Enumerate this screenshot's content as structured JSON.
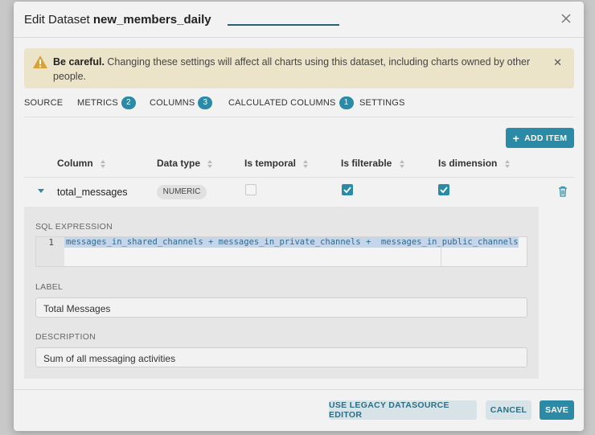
{
  "modal": {
    "title_prefix": "Edit Dataset",
    "dataset_name": "new_members_daily"
  },
  "alert": {
    "strong": "Be careful.",
    "message": "Changing these settings will affect all charts using this dataset, including charts owned by other people."
  },
  "tabs": [
    {
      "label": "SOURCE"
    },
    {
      "label": "METRICS",
      "count": "2"
    },
    {
      "label": "COLUMNS",
      "count": "3"
    },
    {
      "label": "CALCULATED COLUMNS",
      "count": "1",
      "active": true
    },
    {
      "label": "SETTINGS"
    }
  ],
  "add_item_label": "ADD ITEM",
  "table": {
    "headers": [
      "Column",
      "Data type",
      "Is temporal",
      "Is filterable",
      "Is dimension"
    ],
    "row": {
      "name": "total_messages",
      "data_type": "NUMERIC",
      "is_temporal": false,
      "is_filterable": true,
      "is_dimension": true
    }
  },
  "detail": {
    "sql_label": "SQL EXPRESSION",
    "line_number": "1",
    "sql_expression": "messages_in_shared_channels + messages_in_private_channels +  messages_in_public_channels",
    "label_label": "LABEL",
    "label_value": "Total Messages",
    "description_label": "DESCRIPTION",
    "description_value": "Sum of all messaging activities"
  },
  "footer": {
    "legacy_label": "USE LEGACY DATASOURCE EDITOR",
    "cancel_label": "CANCEL",
    "save_label": "SAVE"
  },
  "colors": {
    "accent": "#2b8aa6",
    "warning_bg": "#ece4c8",
    "warning_icon": "#d9a13a"
  }
}
